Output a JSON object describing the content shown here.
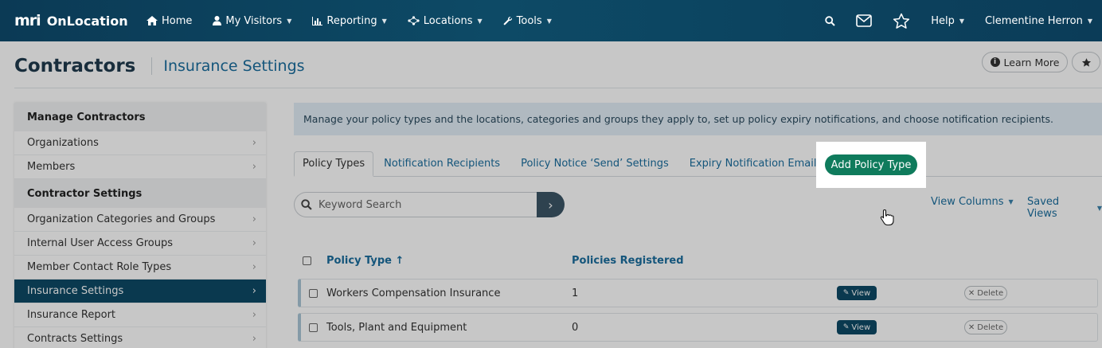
{
  "nav": {
    "logo_mark": "mri",
    "brand": "OnLocation",
    "items": [
      {
        "label": "Home",
        "icon": "home-icon",
        "caret": false
      },
      {
        "label": "My Visitors",
        "icon": "user-icon",
        "caret": true
      },
      {
        "label": "Reporting",
        "icon": "bar-chart-icon",
        "caret": true
      },
      {
        "label": "Locations",
        "icon": "network-icon",
        "caret": true
      },
      {
        "label": "Tools",
        "icon": "wrench-icon",
        "caret": true
      }
    ],
    "help": "Help",
    "user": "Clementine Herron"
  },
  "header": {
    "title": "Contractors",
    "subtitle": "Insurance Settings",
    "learn_more": "Learn More"
  },
  "sidebar": {
    "section1": "Manage Contractors",
    "items1": [
      "Organizations",
      "Members"
    ],
    "section2": "Contractor Settings",
    "items2": [
      "Organization Categories and Groups",
      "Internal User Access Groups",
      "Member Contact Role Types",
      "Insurance Settings",
      "Insurance Report",
      "Contracts Settings"
    ],
    "active": "Insurance Settings"
  },
  "main": {
    "info": "Manage your policy types and the locations, categories and groups they apply to, set up policy expiry notifications, and choose notification recipients.",
    "tabs": [
      "Policy Types",
      "Notification Recipients",
      "Policy Notice ‘Send’ Settings",
      "Expiry Notification Email Editor"
    ],
    "search_placeholder": "Keyword Search",
    "add_button": "Add Policy Type",
    "view_columns": "View Columns",
    "saved_views": "Saved Views",
    "columns": [
      "Policy Type ↑",
      "Policies Registered"
    ],
    "rows": [
      {
        "policy_type": "Workers Compensation Insurance",
        "registered": "1"
      },
      {
        "policy_type": "Tools, Plant and Equipment",
        "registered": "0"
      }
    ],
    "view_label": "View",
    "delete_label": "Delete"
  },
  "colors": {
    "nav_bg": "#0b3a55",
    "accent_blue": "#1a6e9e",
    "add_green": "#0f7b5c",
    "active_item": "#0d4a66"
  }
}
